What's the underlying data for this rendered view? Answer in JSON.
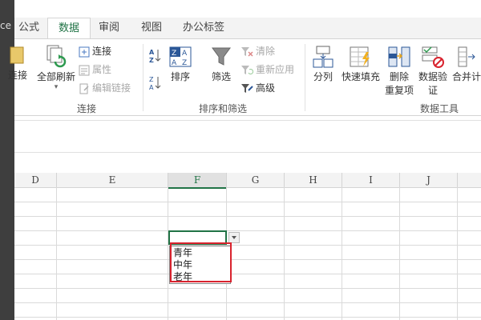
{
  "window": {
    "left_fragment": "ce"
  },
  "tabs": [
    {
      "label": "公式",
      "active": false
    },
    {
      "label": "数据",
      "active": true
    },
    {
      "label": "审阅",
      "active": false
    },
    {
      "label": "视图",
      "active": false
    },
    {
      "label": "办公标签",
      "active": false
    }
  ],
  "ribbon": {
    "connections_group": {
      "label": "连接",
      "partial_button": "连接",
      "refresh_all": "全部刷新",
      "connections": "连接",
      "properties": "属性",
      "edit_links": "编辑链接"
    },
    "sort_filter_group": {
      "label": "排序和筛选",
      "sort": "排序",
      "filter": "筛选",
      "clear": "清除",
      "reapply": "重新应用",
      "advanced": "高级"
    },
    "data_tools_group": {
      "label": "数据工具",
      "text_to_columns": "分列",
      "flash_fill": "快速填充",
      "remove_duplicates_1": "删除",
      "remove_duplicates_2": "重复项",
      "data_validation_1": "数据验",
      "data_validation_2": "证",
      "consolidate": "合并计"
    }
  },
  "grid": {
    "columns": [
      "D",
      "E",
      "F",
      "G",
      "H",
      "I",
      "J"
    ],
    "selected_column": "F"
  },
  "dropdown": {
    "options": [
      "青年",
      "中年",
      "老年"
    ]
  },
  "colors": {
    "accent": "#217346",
    "highlight": "#d9232e"
  }
}
